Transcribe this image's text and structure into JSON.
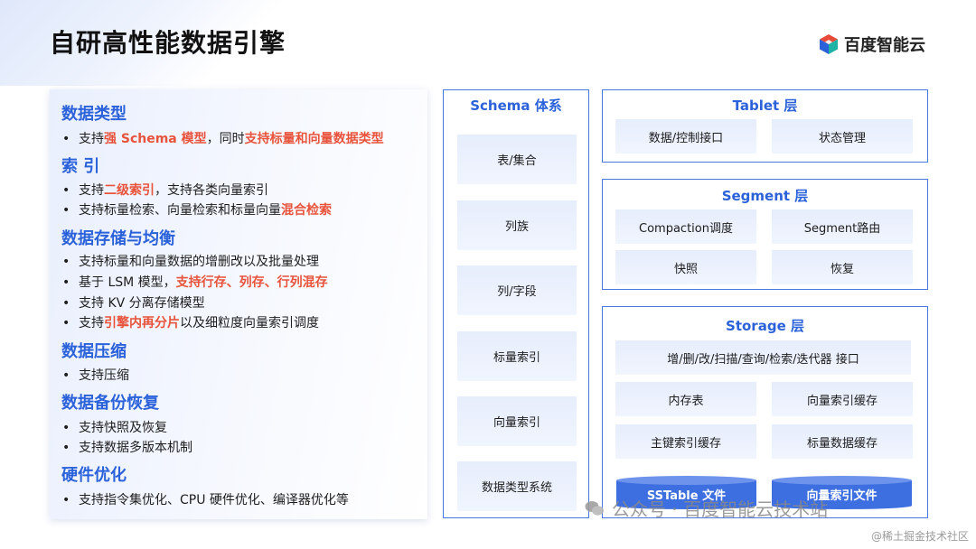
{
  "title": "自研高性能数据引擎",
  "logo_text": "百度智能云",
  "left_sections": [
    {
      "title": "数据类型",
      "bullets": [
        [
          {
            "t": "支持"
          },
          {
            "t": "强 Schema 模型",
            "hl": true
          },
          {
            "t": "，同时"
          },
          {
            "t": "支持标量和向量数据类型",
            "hl": true
          }
        ]
      ]
    },
    {
      "title": "索 引",
      "bullets": [
        [
          {
            "t": "支持"
          },
          {
            "t": "二级索引",
            "hl": true
          },
          {
            "t": "，支持各类向量索引"
          }
        ],
        [
          {
            "t": "支持标量检索、向量检索和标量向量"
          },
          {
            "t": "混合检索",
            "hl": true
          }
        ]
      ]
    },
    {
      "title": "数据存储与均衡",
      "bullets": [
        [
          {
            "t": "支持标量和向量数据的增删改以及批量处理"
          }
        ],
        [
          {
            "t": "基于 LSM 模型，"
          },
          {
            "t": "支持行存、列存、行列混存",
            "hl": true
          }
        ],
        [
          {
            "t": "支持 KV 分离存储模型"
          }
        ],
        [
          {
            "t": "支持"
          },
          {
            "t": "引擎内再分片",
            "hl": true
          },
          {
            "t": "以及细粒度向量索引调度"
          }
        ]
      ]
    },
    {
      "title": "数据压缩",
      "bullets": [
        [
          {
            "t": "支持压缩"
          }
        ]
      ]
    },
    {
      "title": "数据备份恢复",
      "bullets": [
        [
          {
            "t": "支持快照及恢复"
          }
        ],
        [
          {
            "t": "支持数据多版本机制"
          }
        ]
      ]
    },
    {
      "title": "硬件优化",
      "bullets": [
        [
          {
            "t": "支持指令集优化、CPU 硬件优化、编译器优化等"
          }
        ]
      ]
    }
  ],
  "schema": {
    "title": "Schema 体系",
    "items": [
      "表/集合",
      "列族",
      "列/字段",
      "标量索引",
      "向量索引",
      "数据类型系统"
    ]
  },
  "tablet": {
    "title": "Tablet 层",
    "cells": [
      "数据/控制接口",
      "状态管理"
    ]
  },
  "segment": {
    "title": "Segment 层",
    "cells": [
      "Compaction调度",
      "Segment路由",
      "快照",
      "恢复"
    ]
  },
  "storage": {
    "title": "Storage 层",
    "interface": "增/删/改/扫描/查询/检索/迭代器 接口",
    "cells": [
      "内存表",
      "向量索引缓存",
      "主键索引缓存",
      "标量数据缓存"
    ],
    "files": [
      "SSTable 文件",
      "向量索引文件"
    ]
  },
  "watermark": "公众号 · 百度智能云技术站",
  "footer_watermark": "@稀土掘金技术社区",
  "colors": {
    "accent": "#2b62d9",
    "highlight": "#e8533b",
    "border": "#4a78e0",
    "disk": "#3d6fe0"
  }
}
